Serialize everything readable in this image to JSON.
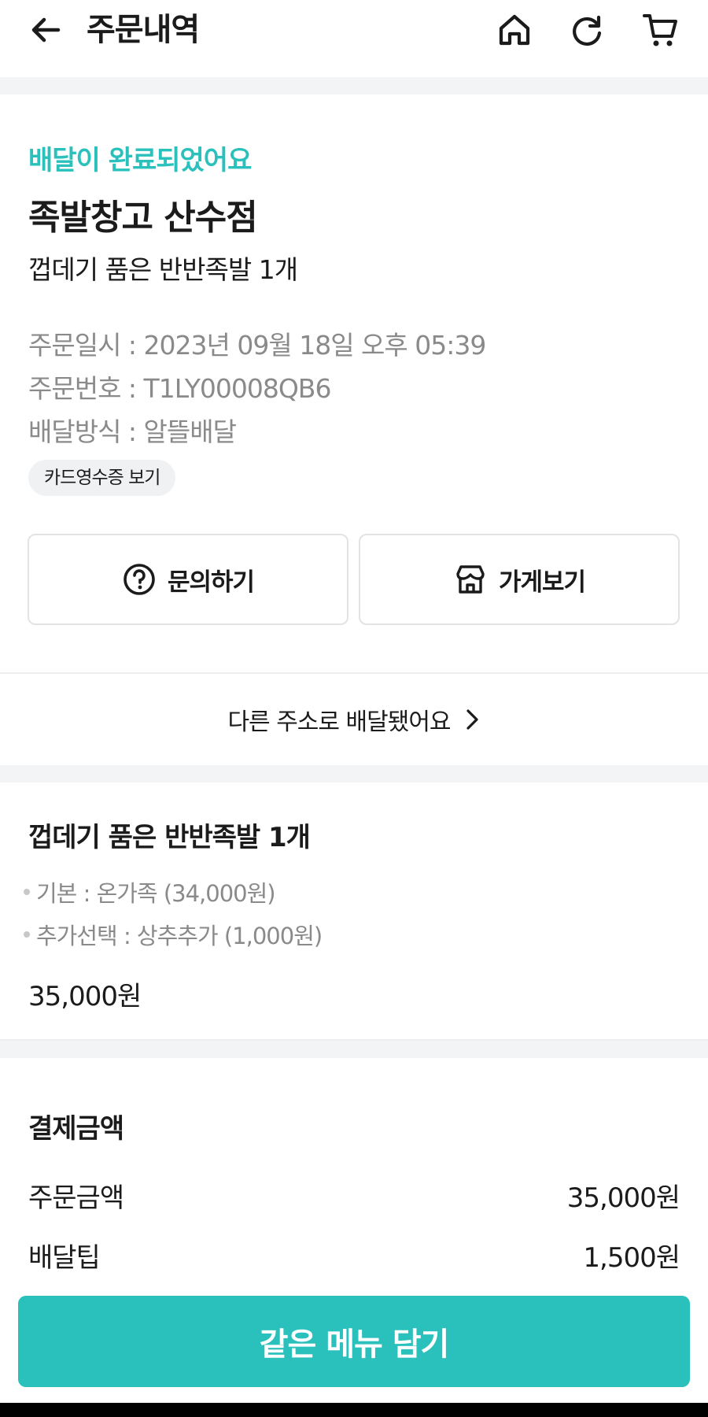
{
  "header": {
    "title": "주문내역"
  },
  "order": {
    "status": "배달이 완료되었어요",
    "store_name": "족발창고 산수점",
    "menu_summary": "껍데기 품은 반반족발 1개",
    "info_lines": [
      "주문일시 : 2023년 09월 18일 오후 05:39",
      "주문번호 : T1LY00008QB6",
      "배달방식 : 알뜰배달"
    ],
    "receipt_label": "카드영수증 보기",
    "inquiry_label": "문의하기",
    "store_view_label": "가게보기",
    "address_notice": "다른 주소로 배달됐어요"
  },
  "item": {
    "name": "껍데기 품은 반반족발 1개",
    "options": [
      "기본 : 온가족 (34,000원)",
      "추가선택 : 상추추가 (1,000원)"
    ],
    "price": "35,000원"
  },
  "payment": {
    "title": "결제금액",
    "rows": [
      {
        "label": "주문금액",
        "value": "35,000원"
      },
      {
        "label": "배달팁",
        "value": "1,500원"
      }
    ]
  },
  "cta": {
    "label": "같은 메뉴 담기"
  },
  "colors": {
    "accent": "#2ac1bc",
    "muted_text": "#8a8a8a",
    "section_gap": "#f3f4f6"
  }
}
